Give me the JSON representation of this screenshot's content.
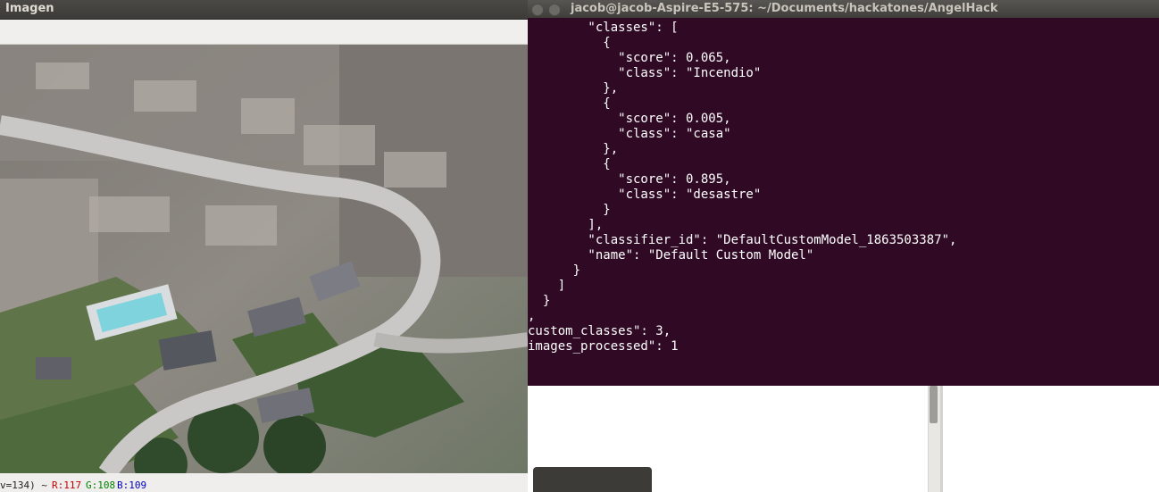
{
  "image_window": {
    "title": "Imagen",
    "status": {
      "coord": "v=134) ~",
      "r": "R:117",
      "g": "G:108",
      "b": "B:109"
    }
  },
  "terminal": {
    "title": "jacob@jacob-Aspire-E5-575: ~/Documents/hackatones/AngelHack",
    "lines": [
      "        \"classes\": [",
      "          {",
      "            \"score\": 0.065,",
      "            \"class\": \"Incendio\"",
      "          },",
      "          {",
      "            \"score\": 0.005,",
      "            \"class\": \"casa\"",
      "          },",
      "          {",
      "            \"score\": 0.895,",
      "            \"class\": \"desastre\"",
      "          }",
      "        ],",
      "        \"classifier_id\": \"DefaultCustomModel_1863503387\",",
      "        \"name\": \"Default Custom Model\"",
      "      }",
      "    ]",
      "  }",
      ",",
      "custom_classes\": 3,",
      "images_processed\": 1"
    ]
  },
  "colors": {
    "terminal_bg": "#300a24",
    "status_r": "#c00000",
    "status_g": "#008000",
    "status_b": "#0000c0"
  }
}
